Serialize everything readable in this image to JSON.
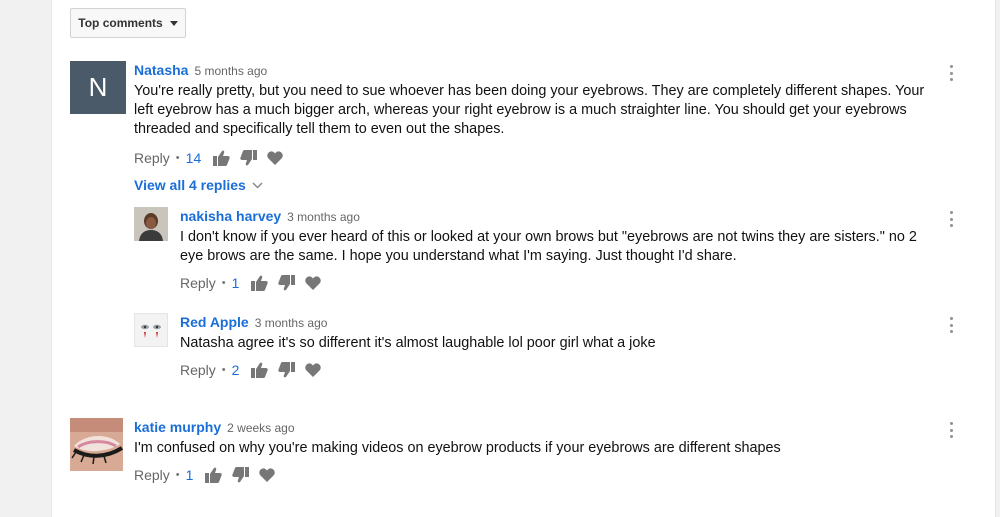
{
  "sort": {
    "label": "Top comments"
  },
  "comments": [
    {
      "initial": "N",
      "author": "Natasha",
      "time": "5 months ago",
      "text": "You're really pretty, but you need to sue whoever has been doing your eyebrows. They are completely different shapes. Your left eyebrow has a much bigger arch, whereas your right eyebrow is a much straighter line. You should get your eyebrows threaded and specifically tell them to even out the shapes.",
      "reply_label": "Reply",
      "like_count": "14"
    },
    {
      "author": "nakisha harvey",
      "time": "3 months ago",
      "text": "I don't know if you ever heard of this or looked at your own brows but \"eyebrows are not twins they are sisters.\" no 2 eye brows are the same.  I hope you understand what I'm saying.  Just thought I'd share.",
      "reply_label": "Reply",
      "like_count": "1"
    },
    {
      "author": "Red Apple",
      "time": "3 months ago",
      "text": "Natasha agree it's so different it's almost laughable lol poor girl what a joke",
      "reply_label": "Reply",
      "like_count": "2"
    },
    {
      "author": "katie murphy",
      "time": "2 weeks ago",
      "text": "I'm confused on why you're making videos on eyebrow products if your eyebrows are different shapes",
      "reply_label": "Reply",
      "like_count": "1"
    }
  ],
  "view_replies": {
    "label": "View all 4 replies"
  },
  "colors": {
    "accent": "#1a6ed8",
    "avatar_n": "#4a5a68",
    "page_bg": "#f1f1f1"
  }
}
